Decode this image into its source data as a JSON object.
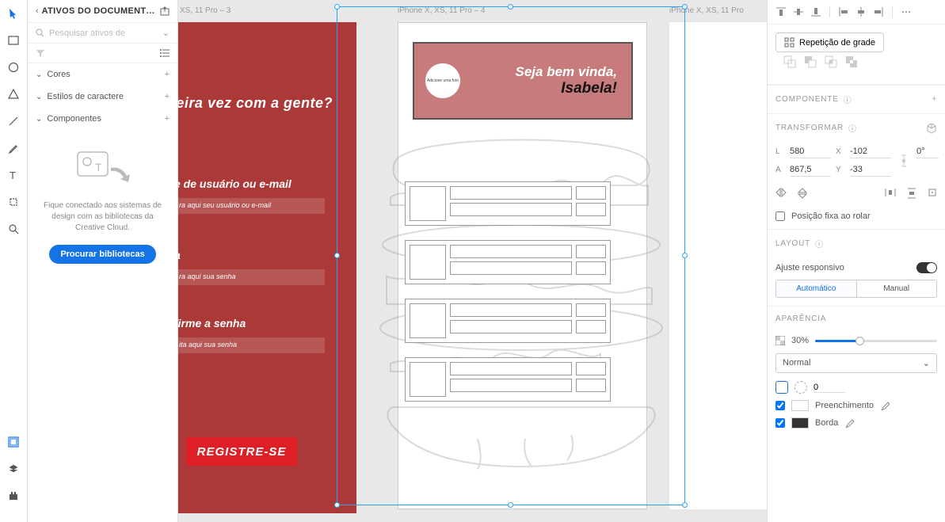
{
  "toolbar": {
    "tools": [
      "select",
      "rectangle",
      "ellipse",
      "polygon",
      "line",
      "pen",
      "text",
      "artboard",
      "zoom"
    ],
    "bottom": [
      "assets",
      "layers",
      "plugins"
    ]
  },
  "assets": {
    "title": "ATIVOS DO DOCUMENT…",
    "search_placeholder": "Pesquisar ativos de",
    "sections": {
      "colors": "Cores",
      "charstyles": "Estilos de caractere",
      "components": "Componentes"
    },
    "promo_msg": "Fique conectado aos sistemas de design com as bibliotecas da Creative Cloud.",
    "promo_btn": "Procurar bibliotecas"
  },
  "canvas": {
    "ab3_label": "XS, 11 Pro – 3",
    "ab4_label": "iPhone X, XS, 11 Pro – 4",
    "ab5_label": "iPhone X, XS, 11 Pro",
    "ab3": {
      "heading": "meira vez com a gente?",
      "label_user": "e de usuário ou e-mail",
      "ph_user": "ra aqui seu usuário ou e-mail",
      "label_pass": "a",
      "ph_pass": "ra aqui sua senha",
      "label_conf": "firme a senha",
      "ph_conf": "ita aqui sua senha",
      "register": "REGISTRE-SE"
    },
    "ab4": {
      "circle_text": "Adicione uma foto",
      "welcome1": "Seja bem vinda,",
      "welcome2": "Isabela!"
    }
  },
  "right": {
    "repeat_label": "Repetição de grade",
    "component_h": "COMPONENTE",
    "transform_h": "TRANSFORMAR",
    "w_label": "L",
    "w_val": "580",
    "x_label": "X",
    "x_val": "-102",
    "h_label": "A",
    "h_val": "867,5",
    "y_label": "Y",
    "y_val": "-33",
    "rot_val": "0°",
    "fix_scroll": "Posição fixa ao rolar",
    "layout_h": "LAYOUT",
    "responsive": "Ajuste responsivo",
    "seg_auto": "Automático",
    "seg_manual": "Manual",
    "appearance_h": "APARÊNCIA",
    "opacity": "30%",
    "blend": "Normal",
    "corner_val": "0",
    "fill_label": "Preenchimento",
    "border_label": "Borda"
  }
}
